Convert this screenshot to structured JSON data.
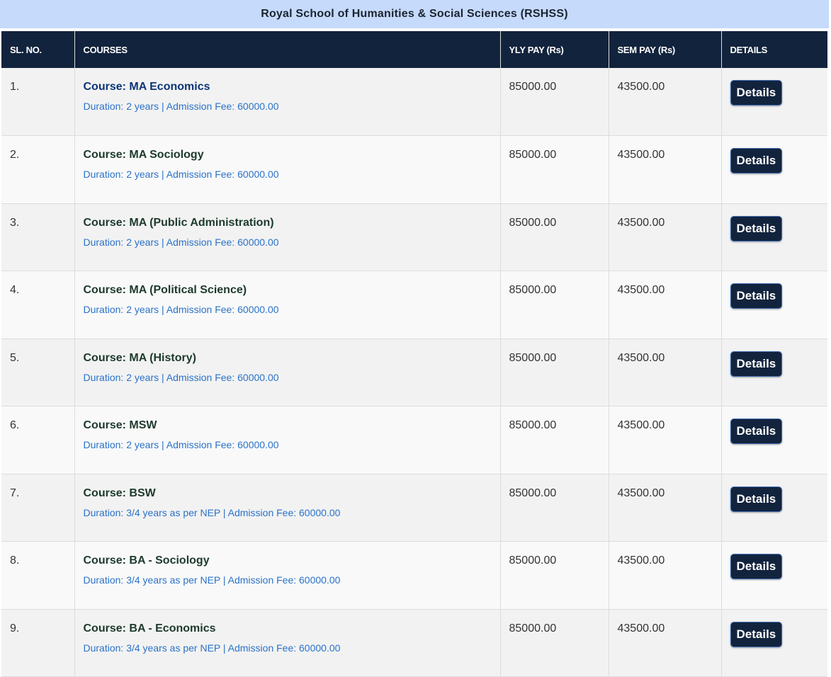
{
  "header": {
    "title": "Royal School of Humanities & Social Sciences (RSHSS)"
  },
  "table": {
    "columns": {
      "sl_no": "SL. NO.",
      "courses": "COURSES",
      "yly_pay": "YLY PAY (Rs)",
      "sem_pay": "SEM PAY (Rs)",
      "details": "DETAILS"
    },
    "button_label": "Details",
    "rows": [
      {
        "sl": "1.",
        "course": "Course: MA Economics",
        "meta": "Duration: 2 years | Admission Fee: 60000.00",
        "yly": "85000.00",
        "sem": "43500.00"
      },
      {
        "sl": "2.",
        "course": "Course: MA Sociology",
        "meta": "Duration: 2 years | Admission Fee: 60000.00",
        "yly": "85000.00",
        "sem": "43500.00"
      },
      {
        "sl": "3.",
        "course": "Course: MA (Public Administration)",
        "meta": "Duration: 2 years | Admission Fee: 60000.00",
        "yly": "85000.00",
        "sem": "43500.00"
      },
      {
        "sl": "4.",
        "course": "Course: MA (Political Science)",
        "meta": "Duration: 2 years | Admission Fee: 60000.00",
        "yly": "85000.00",
        "sem": "43500.00"
      },
      {
        "sl": "5.",
        "course": "Course: MA (History)",
        "meta": "Duration: 2 years | Admission Fee: 60000.00",
        "yly": "85000.00",
        "sem": "43500.00"
      },
      {
        "sl": "6.",
        "course": "Course: MSW",
        "meta": "Duration: 2 years | Admission Fee: 60000.00",
        "yly": "85000.00",
        "sem": "43500.00"
      },
      {
        "sl": "7.",
        "course": "Course: BSW",
        "meta": "Duration: 3/4 years as per NEP | Admission Fee: 60000.00",
        "yly": "85000.00",
        "sem": "43500.00"
      },
      {
        "sl": "8.",
        "course": "Course: BA - Sociology",
        "meta": "Duration: 3/4 years as per NEP | Admission Fee: 60000.00",
        "yly": "85000.00",
        "sem": "43500.00"
      },
      {
        "sl": "9.",
        "course": "Course: BA - Economics",
        "meta": "Duration: 3/4 years as per NEP | Admission Fee: 60000.00",
        "yly": "85000.00",
        "sem": "43500.00"
      }
    ]
  },
  "colors": {
    "header_band": "#c6dafb",
    "table_head": "#12233d",
    "course_meta": "#2a72c9",
    "row_odd": "#f2f2f2",
    "row_even": "#f9f9f9"
  }
}
